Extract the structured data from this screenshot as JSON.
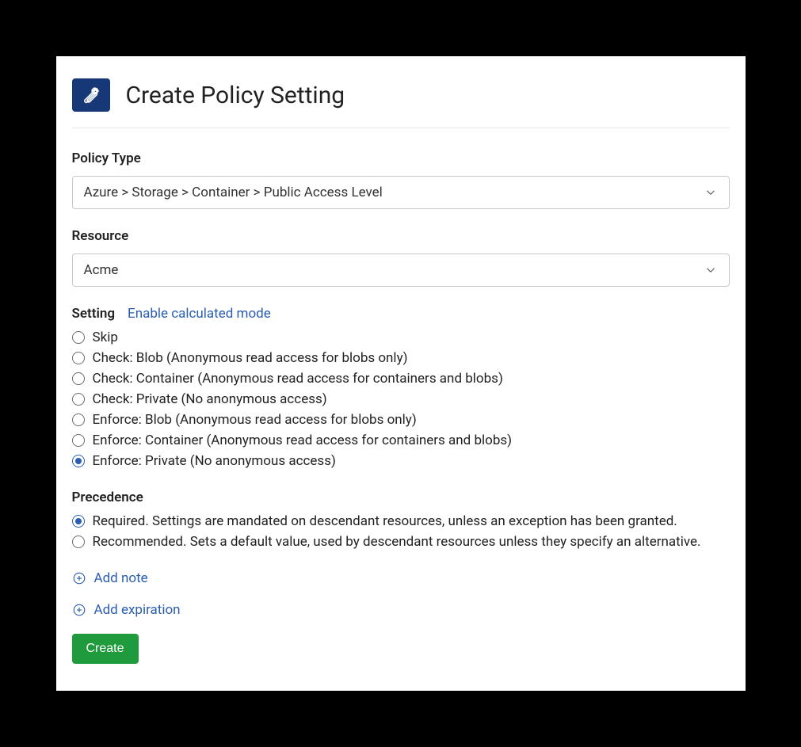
{
  "header": {
    "title": "Create Policy Setting"
  },
  "policy_type": {
    "label": "Policy Type",
    "value": "Azure > Storage > Container > Public Access Level"
  },
  "resource": {
    "label": "Resource",
    "value": "Acme"
  },
  "setting": {
    "label": "Setting",
    "calc_link": "Enable calculated mode",
    "options": [
      "Skip",
      "Check: Blob (Anonymous read access for blobs only)",
      "Check: Container (Anonymous read access for containers and blobs)",
      "Check: Private (No anonymous access)",
      "Enforce: Blob (Anonymous read access for blobs only)",
      "Enforce: Container (Anonymous read access for containers and blobs)",
      "Enforce: Private (No anonymous access)"
    ],
    "selected_index": 6
  },
  "precedence": {
    "label": "Precedence",
    "options": [
      "Required. Settings are mandated on descendant resources, unless an exception has been granted.",
      "Recommended. Sets a default value, used by descendant resources unless they specify an alternative."
    ],
    "selected_index": 0
  },
  "links": {
    "add_note": "Add note",
    "add_expiration": "Add expiration"
  },
  "buttons": {
    "create": "Create"
  }
}
